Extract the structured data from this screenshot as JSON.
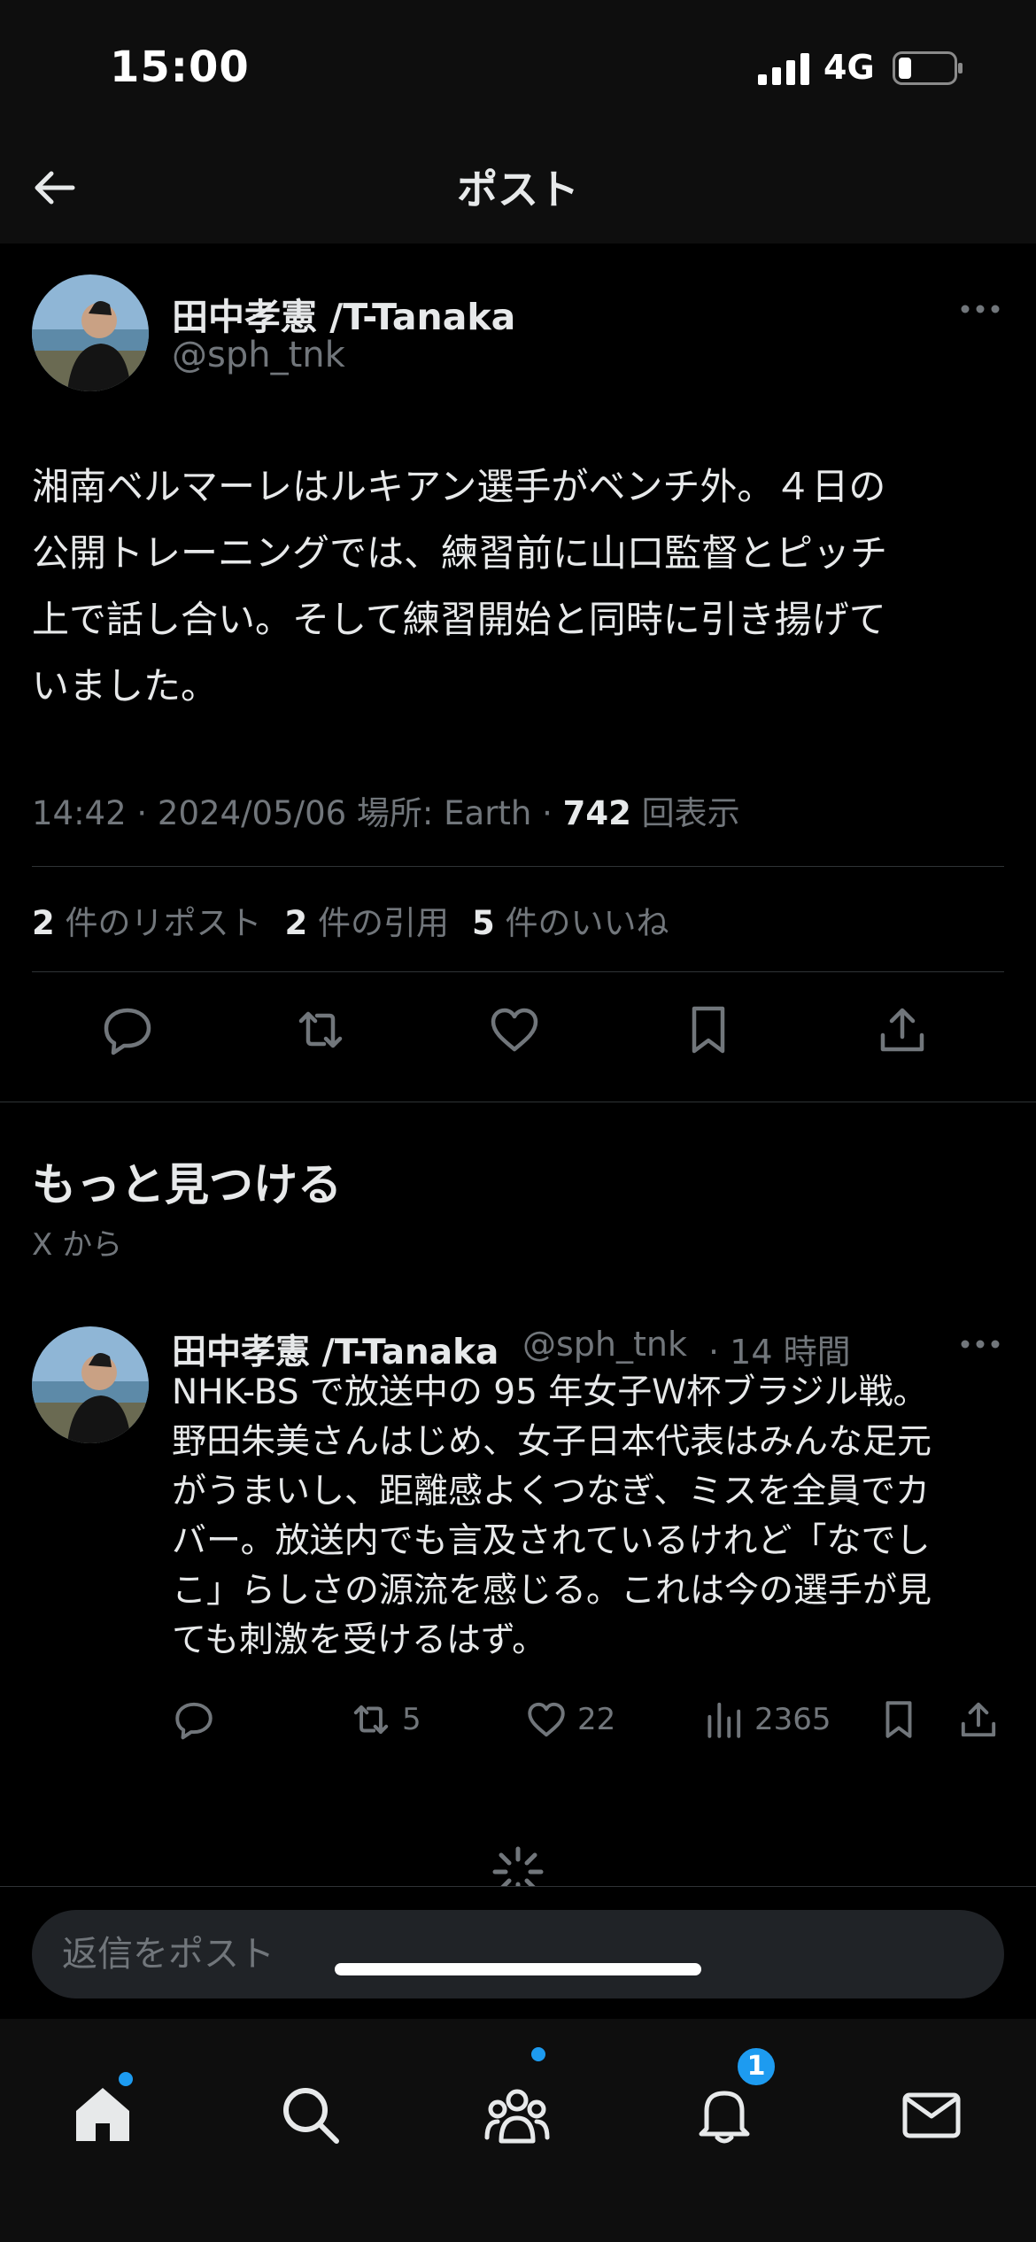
{
  "status_bar": {
    "time": "15:00",
    "network": "4G"
  },
  "header": {
    "title": "ポスト"
  },
  "post": {
    "author_name": "田中孝憲 /T-Tanaka",
    "author_handle": "@sph_tnk",
    "text_lines": [
      "湘南ベルマーレはルキアン選手がベンチ外。４日の",
      "公開トレーニングでは、練習前に山口監督とピッチ",
      "上で話し合い。そして練習開始と同時に引き揚げて",
      "いました。"
    ],
    "meta_prefix": "14:42 · 2024/05/06 場所: Earth · ",
    "views_count": "742",
    "views_label": "回表示",
    "reposts_count": "2",
    "reposts_label": "件のリポスト",
    "quotes_count": "2",
    "quotes_label": "件の引用",
    "likes_count": "5",
    "likes_label": "件のいいね"
  },
  "discover": {
    "title": "もっと見つける",
    "subtitle": "X から"
  },
  "reply": {
    "author_name": "田中孝憲 /T-Tanaka",
    "author_handle": "@sph_tnk",
    "time": "· 14 時間",
    "text_lines": [
      "NHK-BS で放送中の 95 年女子Ｗ杯ブラジル戦。",
      "野田朱美さんはじめ、女子日本代表はみんな足元",
      "がうまいし、距離感よくつなぎ、ミスを全員でカ",
      "バー。放送内でも言及されているけれど「なでし",
      "こ」らしさの源流を感じる。これは今の選手が見",
      "ても刺激を受けるはず。"
    ],
    "reposts": "5",
    "likes": "22",
    "views": "2365"
  },
  "compose": {
    "placeholder": "返信をポスト"
  },
  "tab_bar": {
    "notifications_badge": "1"
  },
  "colors": {
    "accent": "#1d9bf0",
    "muted": "#71767b",
    "text": "#e7e9ea",
    "background": "#000000"
  }
}
